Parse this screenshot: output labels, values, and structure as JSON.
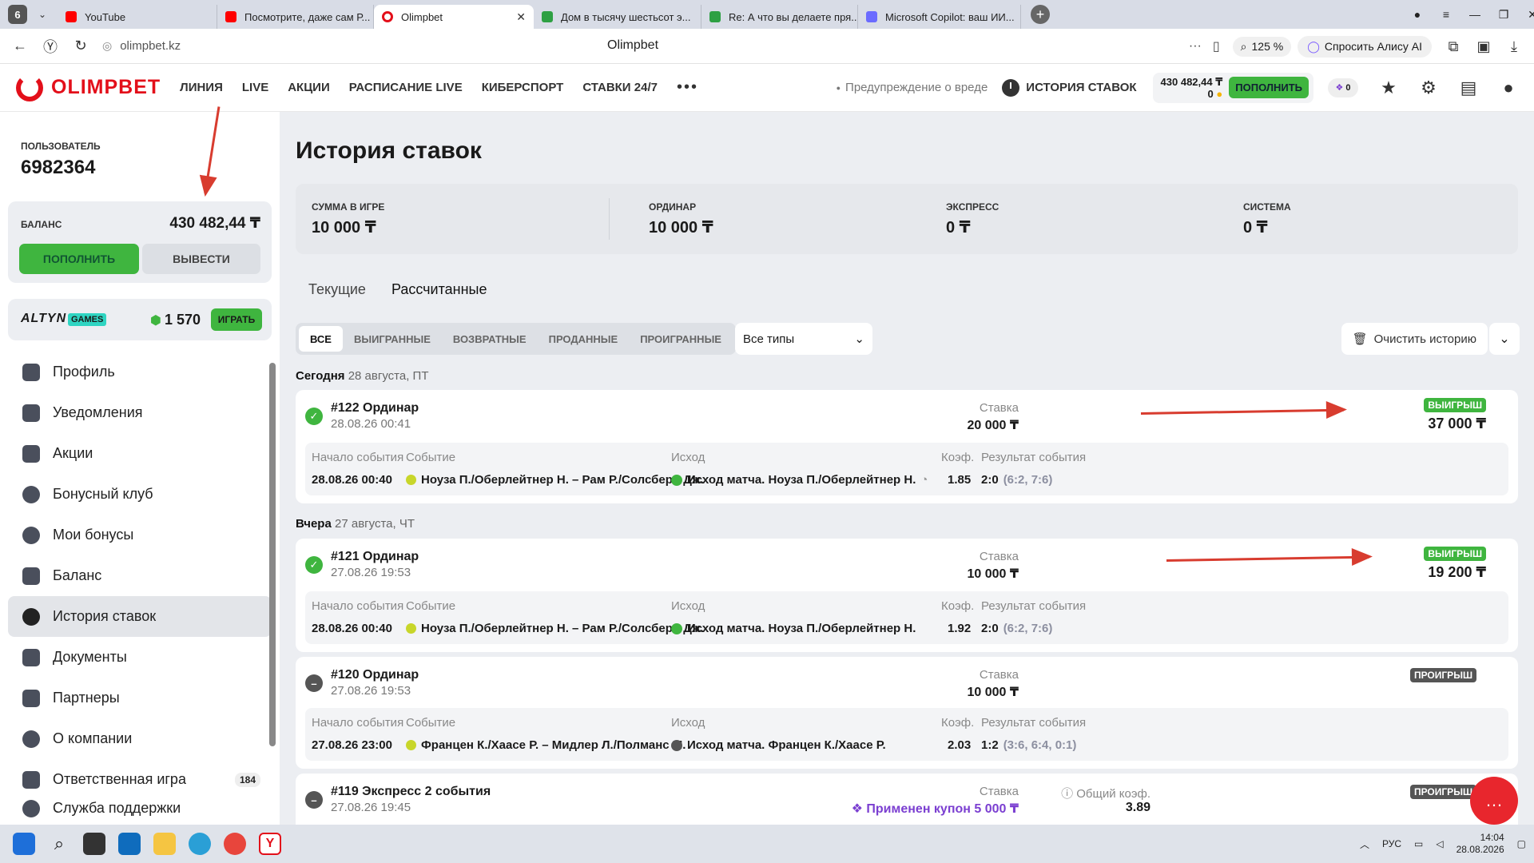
{
  "browser": {
    "tab_count": "6",
    "tabs": [
      {
        "label": "YouTube",
        "color": "#ff0000"
      },
      {
        "label": "Посмотрите, даже сам Р...",
        "color": "#ff0000"
      },
      {
        "label": "Olimpbet",
        "color": "#e30f1a",
        "active": true
      },
      {
        "label": "Дом в тысячу шестьсот э...",
        "color": "#2ea043"
      },
      {
        "label": "Re: А что вы делаете пря...",
        "color": "#2ea043"
      },
      {
        "label": "Microsoft Copilot: ваш ИИ...",
        "color": "#6b6bff"
      }
    ],
    "url": "olimpbet.kz",
    "page_title": "Olimpbet",
    "zoom": "125 %",
    "alisa": "Спросить Алису AI"
  },
  "header": {
    "logo": "OLIMPBET",
    "nav": [
      "ЛИНИЯ",
      "LIVE",
      "АКЦИИ",
      "РАСПИСАНИЕ LIVE",
      "КИБЕРСПОРТ",
      "СТАВКИ 24/7"
    ],
    "warning": "Предупреждение о вреде",
    "history": "ИСТОРИЯ СТАВОК",
    "balance": "430 482,44 ₸",
    "bonus_balance": "0",
    "topup": "ПОПОЛНИТЬ",
    "promo_count": "0"
  },
  "sidebar": {
    "user_label": "ПОЛЬЗОВАТЕЛЬ",
    "user_id": "6982364",
    "balance_label": "БАЛАНС",
    "balance_value": "430 482,44 ₸",
    "topup": "ПОПОЛНИТЬ",
    "withdraw": "ВЫВЕСТИ",
    "altyn_logo": "ALTYN",
    "altyn_games": "GAMES",
    "altyn_points": "1 570",
    "altyn_play": "ИГРАТЬ",
    "menu": [
      {
        "label": "Профиль"
      },
      {
        "label": "Уведомления"
      },
      {
        "label": "Акции"
      },
      {
        "label": "Бонусный клуб"
      },
      {
        "label": "Мои бонусы"
      },
      {
        "label": "Баланс"
      },
      {
        "label": "История ставок",
        "active": true
      },
      {
        "label": "Документы"
      },
      {
        "label": "Партнеры"
      },
      {
        "label": "О компании"
      },
      {
        "label": "Ответственная игра",
        "badge": "184"
      },
      {
        "label": "Служба поддержки"
      }
    ]
  },
  "main": {
    "title": "История ставок",
    "summary": [
      {
        "label": "СУММА В ИГРЕ",
        "value": "10 000 ₸"
      },
      {
        "label": "ОРДИНАР",
        "value": "10 000 ₸"
      },
      {
        "label": "ЭКСПРЕСС",
        "value": "0 ₸"
      },
      {
        "label": "СИСТЕМА",
        "value": "0 ₸"
      }
    ],
    "tabs": [
      "Текущие",
      "Рассчитанные"
    ],
    "filters": [
      "ВСЕ",
      "ВЫИГРАННЫЕ",
      "ВОЗВРАТНЫЕ",
      "ПРОДАННЫЕ",
      "ПРОИГРАННЫЕ"
    ],
    "type_select": "Все типы",
    "clear_history": "Очистить историю",
    "day_today": "Сегодня",
    "day_today_date": "28 августа, ПТ",
    "day_yesterday": "Вчера",
    "day_yesterday_date": "27 августа, ЧТ",
    "col_labels": {
      "start": "Начало события",
      "event": "Событие",
      "outcome": "Исход",
      "coef": "Коэф.",
      "result": "Результат события",
      "stake": "Ставка",
      "total_coef": "Общий коэф."
    },
    "bets": [
      {
        "title": "#122 Ординар",
        "date": "28.08.26 00:41",
        "stake": "20 000 ₸",
        "status": "ВЫИГРЫШ",
        "payout": "37 000 ₸",
        "start": "28.08.26 00:40",
        "event": "Ноуза П./Оберлейтнер Н. – Рам Р./Солсбери Дж.",
        "outcome": "Исход матча. Ноуза П./Оберлейтнер Н.",
        "coef": "1.85",
        "score": "2:0",
        "score_detail": "(6:2, 7:6)"
      },
      {
        "title": "#121 Ординар",
        "date": "27.08.26 19:53",
        "stake": "10 000 ₸",
        "status": "ВЫИГРЫШ",
        "payout": "19 200 ₸",
        "start": "28.08.26 00:40",
        "event": "Ноуза П./Оберлейтнер Н. – Рам Р./Солсбери Дж.",
        "outcome": "Исход матча. Ноуза П./Оберлейтнер Н.",
        "coef": "1.92",
        "score": "2:0",
        "score_detail": "(6:2, 7:6)"
      },
      {
        "title": "#120 Ординар",
        "date": "27.08.26 19:53",
        "stake": "10 000 ₸",
        "status": "ПРОИГРЫШ",
        "start": "27.08.26 23:00",
        "event": "Францен К./Хаасе Р. – Мидлер Л./Полманс М.",
        "outcome": "Исход матча. Францен К./Хаасе Р.",
        "coef": "2.03",
        "score": "1:2",
        "score_detail": "(3:6, 6:4, 0:1)"
      },
      {
        "title": "#119 Экспресс 2 события",
        "date": "27.08.26 19:45",
        "stake": "Применен купон 5 000 ₸",
        "status": "ПРОИГРЫШ",
        "coef": "3.89"
      }
    ]
  },
  "taskbar": {
    "lang": "РУС",
    "time": "14:04",
    "date": "28.08.2026"
  }
}
